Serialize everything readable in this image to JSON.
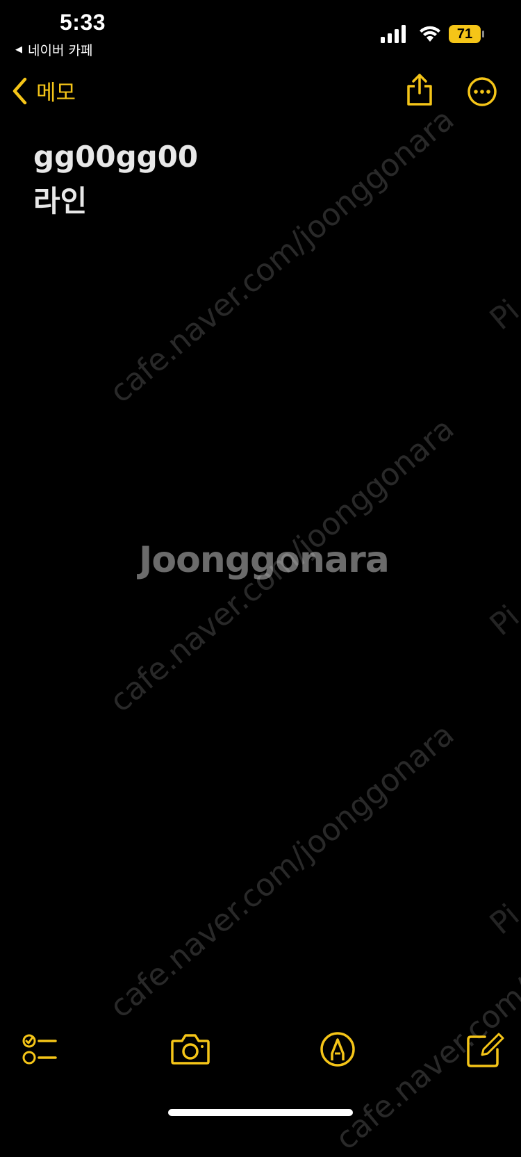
{
  "status_bar": {
    "time": "5:33",
    "back_app_label": "네이버 카페",
    "back_arrow": "◀",
    "battery_level": "71",
    "signal_icon": "cellular-signal-icon",
    "wifi_icon": "wifi-icon",
    "battery_icon": "battery-icon"
  },
  "nav": {
    "back_label": "메모",
    "back_icon": "chevron-left-icon",
    "share_icon": "share-icon",
    "more_icon": "ellipsis-circle-icon"
  },
  "note": {
    "lines": [
      "gg00gg00",
      "라인"
    ]
  },
  "watermark": {
    "url_text": "cafe.naver.com/joonggonara",
    "brand_text": "Joonggonara",
    "side_text": "Pi"
  },
  "toolbar": {
    "checklist_icon": "checklist-icon",
    "camera_icon": "camera-icon",
    "markup_icon": "markup-pen-icon",
    "compose_icon": "compose-icon"
  },
  "colors": {
    "accent": "#f5c518",
    "background": "#000000",
    "text": "#e8e8e8"
  }
}
